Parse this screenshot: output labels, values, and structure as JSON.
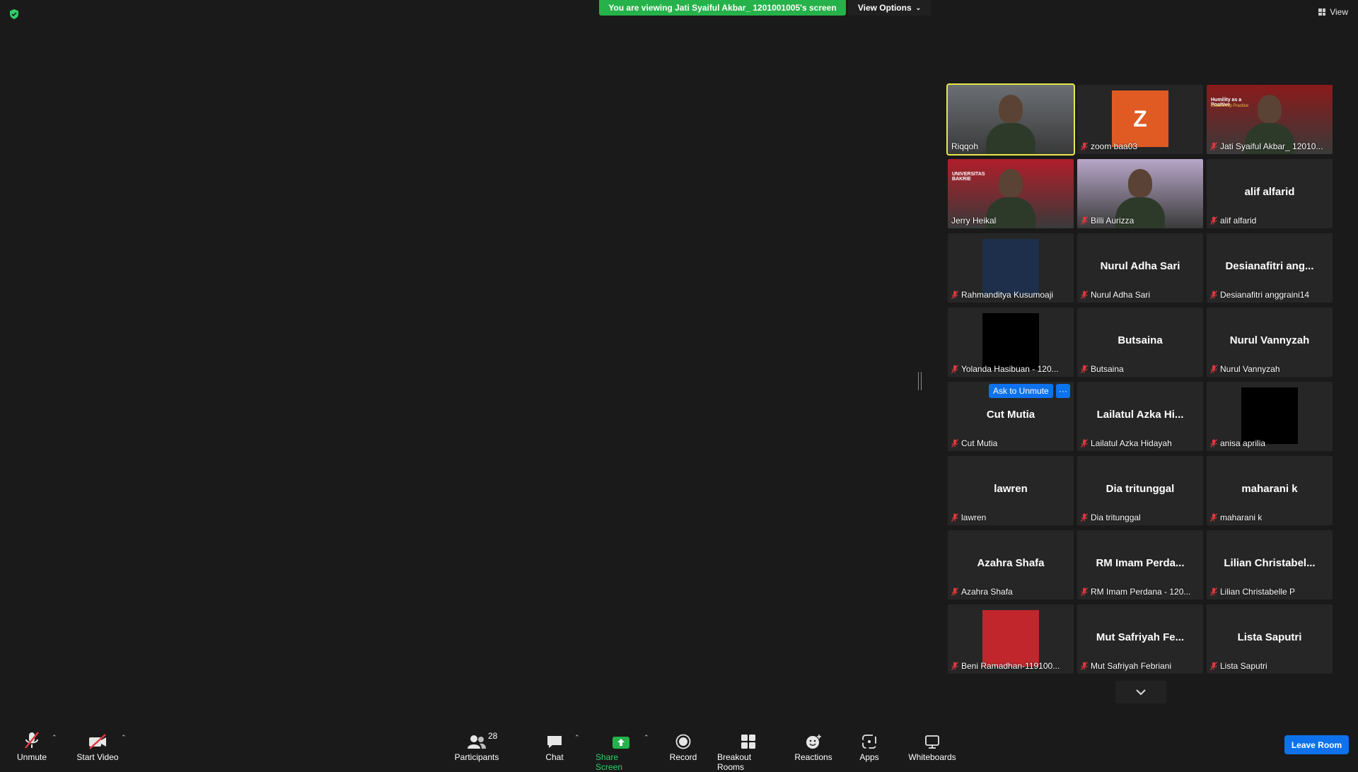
{
  "banner": {
    "text": "You are viewing Jati Syaiful Akbar_ 1201001005's screen"
  },
  "view_options": {
    "label": "View Options"
  },
  "view_button": {
    "label": "View"
  },
  "gallery": {
    "ask_to_unmute": "Ask to Unmute",
    "ask_more": "···",
    "tiles": [
      {
        "label": "Riqqoh",
        "muted": false,
        "kind": "video",
        "color": "#6b6f74",
        "active": true
      },
      {
        "label": "zoom baa03",
        "muted": true,
        "kind": "avatar",
        "avatar_letter": "Z",
        "color": "#e05a24"
      },
      {
        "label": "Jati Syaiful Akbar_ 12010...",
        "muted": true,
        "kind": "video",
        "color": "#8b1a1a",
        "slide_title": "Humility as a Positive",
        "slide_subtitle": "Leadership Practice"
      },
      {
        "label": "Jerry Heikal",
        "muted": false,
        "kind": "video",
        "color": "#b01e2a",
        "slide_title": "UNIVERSITAS BAKRIE"
      },
      {
        "label": "Billi Aurizza",
        "muted": true,
        "kind": "video",
        "color": "#b8a7c9"
      },
      {
        "label": "alif alfarid",
        "muted": true,
        "kind": "name",
        "center": "alif alfarid"
      },
      {
        "label": "Rahmanditya Kusumoaji",
        "muted": true,
        "kind": "thumb",
        "color": "#1d2f4a"
      },
      {
        "label": "Nurul Adha Sari",
        "muted": true,
        "kind": "name",
        "center": "Nurul Adha Sari"
      },
      {
        "label": "Desianafitri anggraini14",
        "muted": true,
        "kind": "name",
        "center": "Desianafitri  ang..."
      },
      {
        "label": "Yolanda Hasibuan - 120...",
        "muted": true,
        "kind": "thumb",
        "color": "#000000"
      },
      {
        "label": "Butsaina",
        "muted": true,
        "kind": "name",
        "center": "Butsaina"
      },
      {
        "label": "Nurul Vannyzah",
        "muted": true,
        "kind": "name",
        "center": "Nurul Vannyzah"
      },
      {
        "label": "Cut Mutia",
        "muted": true,
        "kind": "name",
        "center": "Cut Mutia",
        "hover": true
      },
      {
        "label": "Lailatul Azka Hidayah",
        "muted": true,
        "kind": "name",
        "center": "Lailatul  Azka  Hi..."
      },
      {
        "label": "anisa aprilia",
        "muted": true,
        "kind": "thumb",
        "color": "#000000"
      },
      {
        "label": "lawren",
        "muted": true,
        "kind": "name",
        "center": "lawren"
      },
      {
        "label": "Dia tritunggal",
        "muted": true,
        "kind": "name",
        "center": "Dia tritunggal"
      },
      {
        "label": "maharani k",
        "muted": true,
        "kind": "name",
        "center": "maharani k"
      },
      {
        "label": "Azahra Shafa",
        "muted": true,
        "kind": "name",
        "center": "Azahra Shafa"
      },
      {
        "label": "RM Imam Perdana - 120...",
        "muted": true,
        "kind": "name",
        "center": "RM  Imam  Perda..."
      },
      {
        "label": "Lilian Christabelle P",
        "muted": true,
        "kind": "name",
        "center": "Lilian  Christabel..."
      },
      {
        "label": "Beni Ramadhan-119100...",
        "muted": true,
        "kind": "thumb",
        "color": "#c0262c"
      },
      {
        "label": "Mut Safriyah Febriani",
        "muted": true,
        "kind": "name",
        "center": "Mut  Safriyah  Fe..."
      },
      {
        "label": "Lista Saputri",
        "muted": true,
        "kind": "name",
        "center": "Lista Saputri"
      }
    ]
  },
  "toolbar": {
    "unmute": "Unmute",
    "start_video": "Start Video",
    "participants": "Participants",
    "participants_count": "28",
    "chat": "Chat",
    "share_screen": "Share Screen",
    "record": "Record",
    "breakout_rooms": "Breakout Rooms",
    "reactions": "Reactions",
    "apps": "Apps",
    "whiteboards": "Whiteboards",
    "leave_room": "Leave Room"
  },
  "colors": {
    "accent_blue": "#0e72ed",
    "banner_green": "#26b24a",
    "active_speaker": "#e8e84a",
    "muted_red": "#e0383e"
  }
}
